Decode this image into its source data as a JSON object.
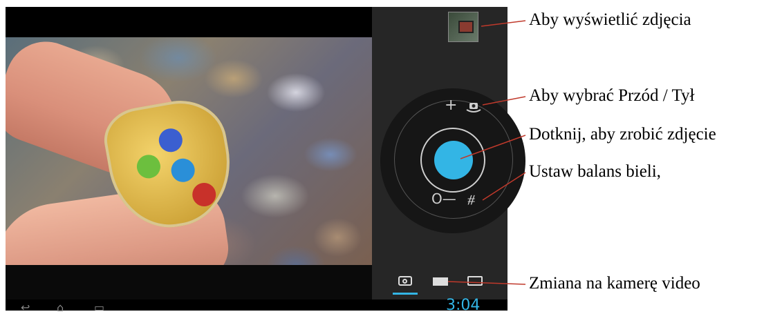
{
  "callouts": {
    "view_photos": "Aby wyświetlić zdjęcia",
    "front_back": "Aby wybrać Przód / Tył",
    "take_photo": "Dotknij, aby zrobić zdjęcie",
    "white_balance": "Ustaw balans bieli,",
    "switch_video": "Zmiana na kamerę video"
  },
  "camera": {
    "zoom_in_symbol": "+",
    "zoom_out_symbol": "O—",
    "white_balance_symbol": "⧣",
    "shutter_color": "#33b5e5"
  },
  "status_bar": {
    "time": "3:04"
  },
  "icons": [
    "gallery-thumbnail-icon",
    "switch-camera-icon",
    "zoom-in-icon",
    "zoom-out-icon",
    "white-balance-icon",
    "camera-mode-icon",
    "video-mode-icon",
    "panorama-mode-icon",
    "back-icon",
    "home-icon",
    "recent-apps-icon"
  ]
}
